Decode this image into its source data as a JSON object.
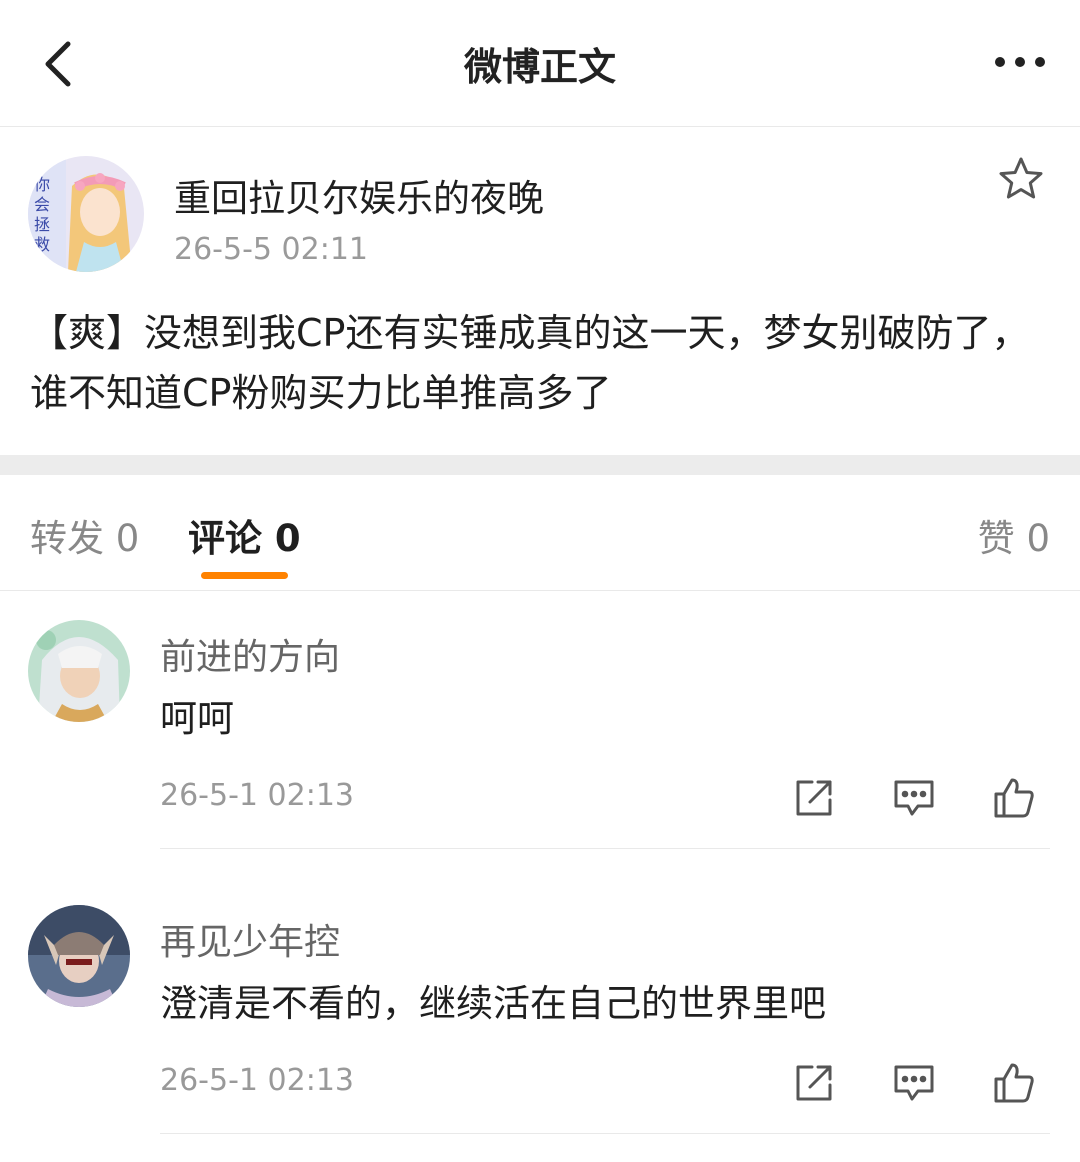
{
  "header": {
    "title": "微博正文",
    "back_icon": "chevron-left-icon",
    "more_icon": "more-dots-icon"
  },
  "post": {
    "author": "重回拉贝尔娱乐的夜晚",
    "time": "26-5-5 02:11",
    "text": "【爽】没想到我CP还有实锤成真的这一天，梦女别破防了，谁不知道CP粉购买力比单推高多了",
    "avatar_text": "你会拯救我"
  },
  "tabs": {
    "repost": "转发 0",
    "comment": "评论 0",
    "like": "赞 0"
  },
  "comments": [
    {
      "name": "前进的方向",
      "text": "呵呵",
      "time": "26-5-1 02:13"
    },
    {
      "name": "再见少年控",
      "text": "澄清是不看的，继续活在自己的世界里吧",
      "time": "26-5-1 02:13"
    }
  ],
  "colors": {
    "accent": "#ff8200",
    "divider": "#e9e9e9",
    "muted": "#999999"
  }
}
